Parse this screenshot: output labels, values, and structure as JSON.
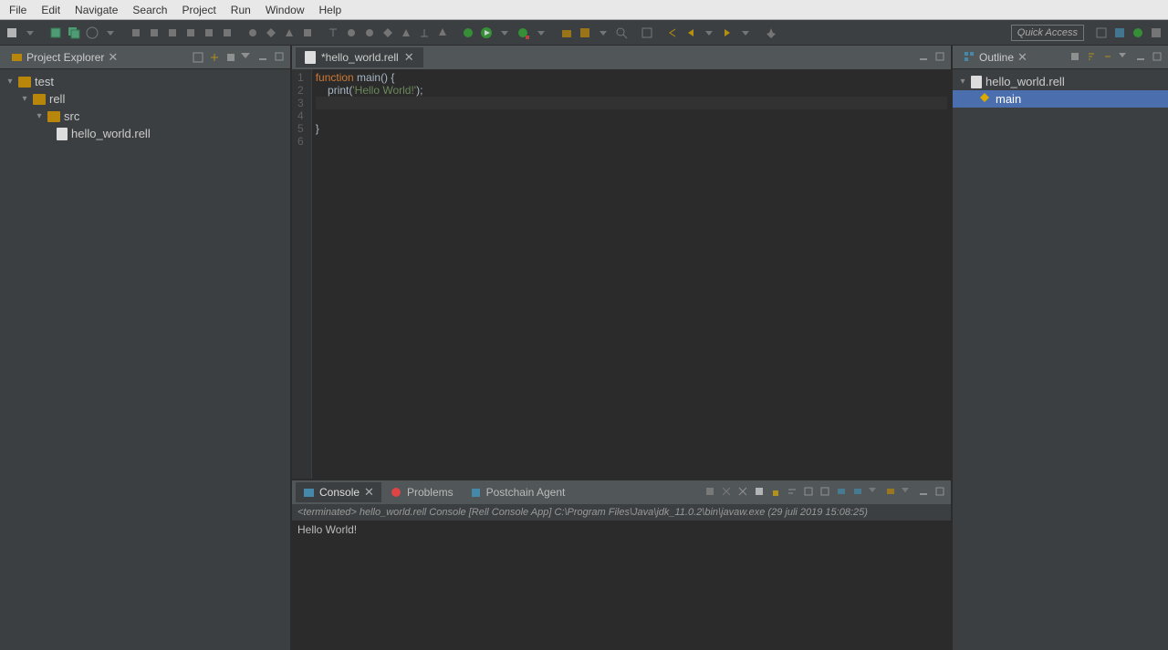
{
  "menu": [
    "File",
    "Edit",
    "Navigate",
    "Search",
    "Project",
    "Run",
    "Window",
    "Help"
  ],
  "quick_access": "Quick Access",
  "project_explorer": {
    "title": "Project Explorer",
    "tree": {
      "root": "test",
      "child1": "rell",
      "child2": "src",
      "file": "hello_world.rell"
    }
  },
  "editor": {
    "tab_title": "*hello_world.rell",
    "lines": {
      "l1_kw": "function",
      "l1_rest": " main() {",
      "l2_pre": "    print(",
      "l2_str": "'Hello World!'",
      "l2_post": ");",
      "l5": "}"
    },
    "line_numbers": [
      "1",
      "2",
      "3",
      "4",
      "5",
      "6"
    ]
  },
  "outline": {
    "title": "Outline",
    "file": "hello_world.rell",
    "symbol": "main"
  },
  "console": {
    "tabs": {
      "console": "Console",
      "problems": "Problems",
      "postchain": "Postchain Agent"
    },
    "header": "<terminated> hello_world.rell Console [Rell Console App] C:\\Program Files\\Java\\jdk_11.0.2\\bin\\javaw.exe (29 juli 2019 15:08:25)",
    "output": "Hello World!"
  }
}
